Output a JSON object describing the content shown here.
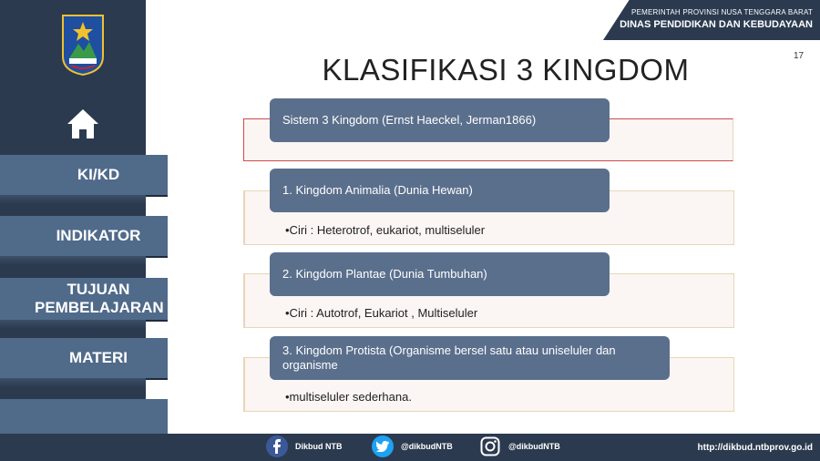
{
  "header": {
    "line1": "PEMERINTAH PROVINSI NUSA TENGGARA BARAT",
    "line2": "DINAS PENDIDIKAN DAN KEBUDAYAAN"
  },
  "page_number": "17",
  "title": "KLASIFIKASI 3 KINGDOM",
  "sidebar": {
    "items": [
      {
        "label": "KI/KD"
      },
      {
        "label": "INDIKATOR"
      },
      {
        "label": "TUJUAN PEMBELAJARAN"
      },
      {
        "label": "MATERI"
      },
      {
        "label": ""
      }
    ]
  },
  "content": {
    "sections": [
      {
        "heading": "Sistem 3 Kingdom (Ernst Haeckel, Jerman1866)",
        "text": ""
      },
      {
        "heading": "1. Kingdom Animalia (Dunia Hewan)",
        "text": "•Ciri : Heterotrof, eukariot, multiseluler"
      },
      {
        "heading": "2. Kingdom Plantae (Dunia Tumbuhan)",
        "text": "•Ciri :  Autotrof, Eukariot , Multiseluler"
      },
      {
        "heading": "3. Kingdom Protista (Organisme bersel satu atau uniseluler dan organisme",
        "text": "•multiseluler sederhana."
      }
    ]
  },
  "footer": {
    "facebook": "Dikbud NTB",
    "twitter": "@dikbudNTB",
    "instagram": "@dikbudNTB",
    "url": "http://dikbud.ntbprov.go.id"
  },
  "colors": {
    "sidebar": "#2b3a4f",
    "tab": "#506a8a",
    "pill": "#5a6f8c",
    "facebook": "#3b5998",
    "twitter": "#1da1f2"
  }
}
